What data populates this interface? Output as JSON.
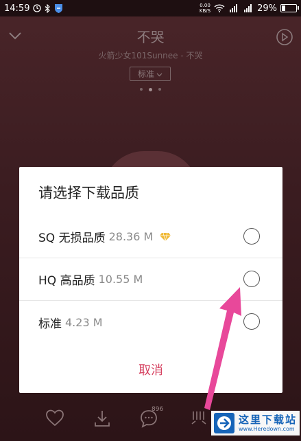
{
  "status_bar": {
    "time": "14:59",
    "net_speed_value": "0.00",
    "net_speed_unit": "KB/S",
    "battery": "29%",
    "battery_level": 0.29
  },
  "player": {
    "song_title": "不哭",
    "artist_line": "火箭少女101Sunnee - 不哭",
    "quality_chip": "标准",
    "pager_dots": 3,
    "pager_active": 1
  },
  "dialog": {
    "title": "请选择下载品质",
    "options": [
      {
        "name": "SQ 无损品质",
        "size": "28.36 M",
        "has_vip_badge": true
      },
      {
        "name": "HQ 高品质",
        "size": "10.55 M",
        "has_vip_badge": false
      },
      {
        "name": "标准",
        "size": "4.23 M",
        "has_vip_badge": false
      }
    ],
    "cancel_label": "取消"
  },
  "bottom_bar": {
    "comment_count": "896"
  },
  "watermark": {
    "title": "这里下载站",
    "url": "www.Heredown.com"
  },
  "colors": {
    "accent": "#d64261",
    "arrow": "#e8489a",
    "dialog_bg": "#ffffff",
    "backdrop": "#3a1c20",
    "watermark_blue": "#1664b8"
  }
}
